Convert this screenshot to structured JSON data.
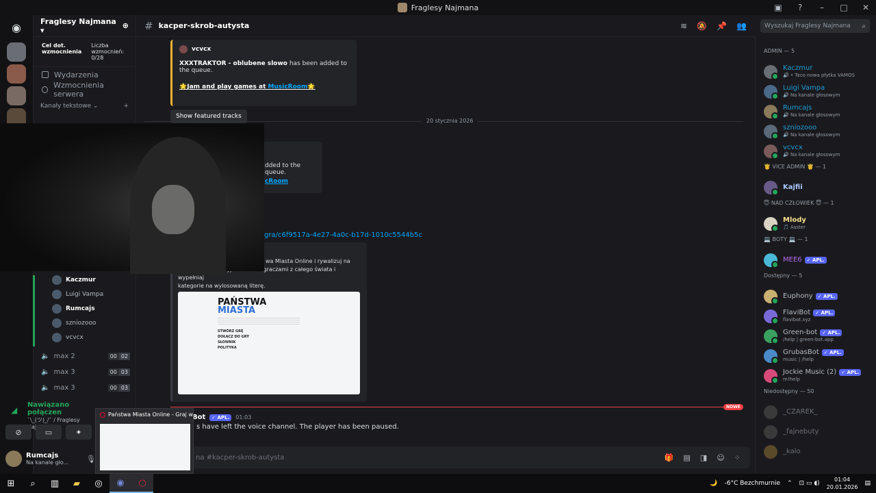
{
  "window": {
    "title": "Fraglesy Najmana"
  },
  "server": {
    "name": "Fraglesy Najmana ▾",
    "boost_goal": "Cel dot. wzmocnienia",
    "boost_count": "Liczba wzmocnień: 0/28"
  },
  "sidebar": {
    "events": "Wydarzenia",
    "boosts": "Wzmocnienia serwera",
    "text_channels": "Kanały tekstowe ⌄"
  },
  "voice_members": [
    "Kaczmur",
    "Luigi Vampa",
    "Rumcajs",
    "szniozooo",
    "vcvcx"
  ],
  "voice_channels": [
    {
      "name": "max 2",
      "a": "00",
      "b": "02"
    },
    {
      "name": "max 3",
      "a": "00",
      "b": "03"
    },
    {
      "name": "max 3",
      "a": "00",
      "b": "03"
    }
  ],
  "voice_status": {
    "title": "Nawiązano połączen",
    "sub": "¯\\_(ツ)_/¯ / Fraglesy Naj..."
  },
  "user": {
    "name": "Rumcajs",
    "status": "Na kanale gło..."
  },
  "channel": {
    "name": "kacper-skrob-autysta"
  },
  "search": {
    "placeholder": "Wyszukaj Fraglesy Najmana"
  },
  "messages": {
    "embed1_author": "vcvcx",
    "embed1_track": "XXXTRAKTOR - oblubene slowo",
    "embed1_rest": " has been added to the queue.",
    "embed1_link_pre": "Jam and play games at ",
    "embed1_link": "MusicRoom",
    "featured": "Show featured tracks",
    "date_divider": "20 stycznia 2026",
    "embed2_text": "dded to the queue.",
    "embed2_link": "cRoom",
    "url_fragment": "gra/c6f9517a-4e27-4a0c-b17d-1010c5544b5c",
    "embed3_desc1": "wa Miasta Online i rywalizuj na",
    "embed3_desc2": "wiedzę. Graj z przyjaciółmi lub graczami z całego świata i wypełniaj",
    "embed3_desc3": "kategorie na wylosowaną literę.",
    "preview_title1": "PAŃSTWA",
    "preview_title2": "MIASTA",
    "preview_menu": [
      "STWÓRZ GRĘ",
      "DOŁĄCZ DO GRY",
      "SŁOWNIK",
      "POLITYKA"
    ],
    "new_badge": "NOWE",
    "bot_name": "Bot",
    "bot_tag": "APL.",
    "bot_time": "01:03",
    "bot_text": "s have left the voice channel. The player has been paused."
  },
  "composer": {
    "placeholder": "na #kacper-skrob-autysta"
  },
  "popup": {
    "title": "Państwa Miasta Online - Graj w..."
  },
  "member_groups": [
    {
      "label": "ADMIN — 5",
      "members": [
        {
          "name": "Kaczmur",
          "status": "🔊 • Taco nowa płytka VAMOS",
          "color": "#1e9bd8"
        },
        {
          "name": "Luigi Vampa",
          "status": "🔊 Na kanale głosowym",
          "color": "#1e9bd8"
        },
        {
          "name": "Rumcajs",
          "status": "🔊 Na kanale głosowym",
          "color": "#1e9bd8"
        },
        {
          "name": "szniozooo",
          "status": "🔊 Na kanale głosowym",
          "color": "#1e9bd8"
        },
        {
          "name": "vcvcx",
          "status": "🔊 Na kanale głosowym",
          "color": "#1e9bd8"
        }
      ]
    },
    {
      "label": "🤴 VICE ADMIN 🤴 — 1",
      "members": [
        {
          "name": "Kajfii",
          "status": "",
          "color": "#a9c9ff"
        }
      ]
    },
    {
      "label": "😇 NAD CZŁOWIEK 😇 — 1",
      "members": [
        {
          "name": "Mlody",
          "status": "🎵 Asster",
          "color": "#f5e08a"
        }
      ]
    },
    {
      "label": "💻 BOTY 💻 — 1",
      "members": [
        {
          "name": "MEE6",
          "status": "",
          "color": "#b96cf0",
          "tag": "APL."
        }
      ]
    },
    {
      "label": "Dostępny — 5",
      "members": [
        {
          "name": "Euphony",
          "status": "",
          "color": "#b5bac1",
          "tag": "APL."
        },
        {
          "name": "FlaviBot",
          "status": "flavibot.xyz",
          "color": "#b5bac1",
          "tag": "APL."
        },
        {
          "name": "Green-bot",
          "status": "/help | green-bot.app",
          "color": "#b5bac1",
          "tag": "APL."
        },
        {
          "name": "GrubasBot",
          "status": "music | /help",
          "color": "#b5bac1",
          "tag": "APL."
        },
        {
          "name": "Jockie Music (2)",
          "status": "m!help",
          "color": "#b5bac1",
          "tag": "APL."
        }
      ]
    },
    {
      "label": "Niedostępny — 50",
      "offline": true,
      "members": [
        {
          "name": "_CZAREK_",
          "status": "",
          "color": "#6d6f78"
        },
        {
          "name": "_fajnebuty",
          "status": "",
          "color": "#6d6f78"
        },
        {
          "name": "_kalo",
          "status": "",
          "color": "#6d6f78"
        }
      ]
    }
  ],
  "taskbar": {
    "weather": "-6°C  Bezchmurnie",
    "time": "01:04",
    "date": "20.01.2026"
  }
}
